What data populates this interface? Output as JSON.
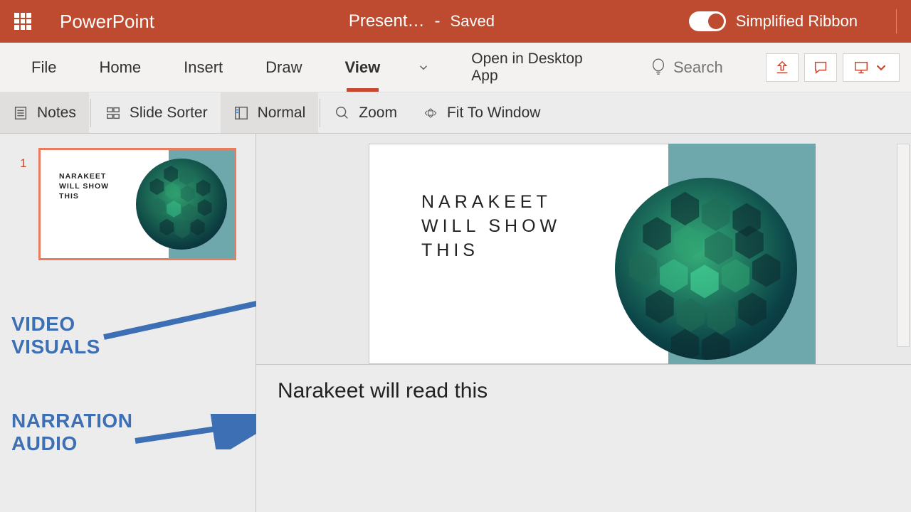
{
  "titlebar": {
    "app_name": "PowerPoint",
    "doc_name": "Present…",
    "dash": "-",
    "saved_label": "Saved",
    "toggle_label": "Simplified Ribbon",
    "toggle_on": true
  },
  "tabs": {
    "file": "File",
    "home": "Home",
    "insert": "Insert",
    "draw": "Draw",
    "view": "View",
    "open_desktop": "Open in Desktop App",
    "search_placeholder": "Search"
  },
  "toolbar": {
    "notes": "Notes",
    "slide_sorter": "Slide Sorter",
    "normal": "Normal",
    "zoom": "Zoom",
    "fit_window": "Fit To Window"
  },
  "thumb": {
    "number": "1",
    "text_lines": [
      "NARAKEET",
      "WILL SHOW",
      "THIS"
    ]
  },
  "slide": {
    "text_lines": [
      "NARAKEET",
      "WILL SHOW",
      "THIS"
    ]
  },
  "notes": {
    "text": "Narakeet will read this"
  },
  "annotations": {
    "a1_line1": "VIDEO",
    "a1_line2": "VISUALS",
    "a2_line1": "NARRATION",
    "a2_line2": "AUDIO"
  },
  "icons": {
    "waffle": "app-launcher-icon",
    "chevron_down": "chevron-down-icon"
  }
}
